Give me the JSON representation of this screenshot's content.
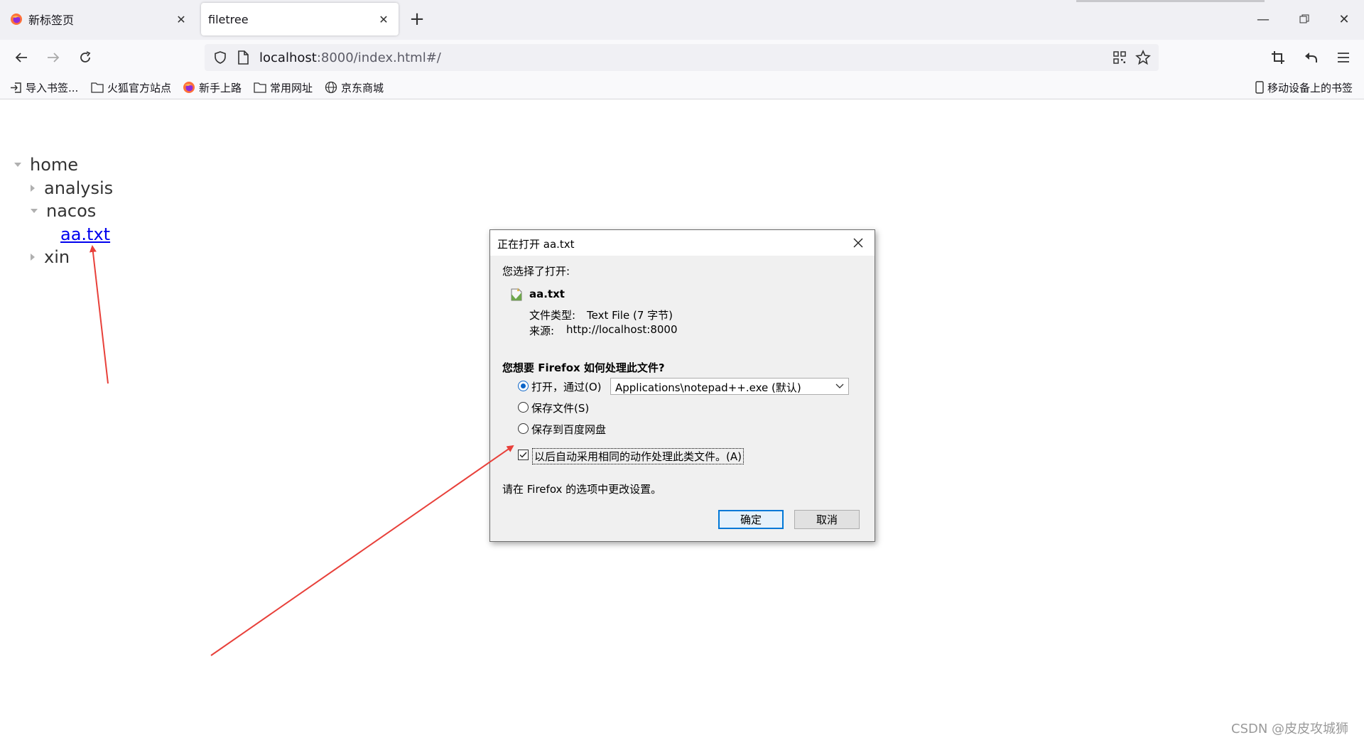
{
  "browser": {
    "tabs": [
      {
        "title": "新标签页"
      },
      {
        "title": "filetree"
      }
    ],
    "url": {
      "host": "localhost",
      "rest": ":8000/index.html#/"
    },
    "bookmarks": [
      {
        "label": "导入书签..."
      },
      {
        "label": "火狐官方站点"
      },
      {
        "label": "新手上路"
      },
      {
        "label": "常用网址"
      },
      {
        "label": "京东商城"
      }
    ],
    "mobile_bookmarks": "移动设备上的书签",
    "colors": {
      "toolbar": "#f9f9fb",
      "tabstrip": "#f0f0f4",
      "link": "#0000ee",
      "accent": "#0078d7"
    }
  },
  "tree": {
    "root": "home",
    "children": [
      {
        "label": "analysis"
      },
      {
        "label": "nacos"
      },
      {
        "label": "aa.txt"
      },
      {
        "label": "xin"
      }
    ]
  },
  "dialog": {
    "title": "正在打开 aa.txt",
    "chosen_label": "您选择了打开:",
    "file_name": "aa.txt",
    "type_label": "文件类型:",
    "type_value": "Text File (7 字节)",
    "source_label": "来源:",
    "source_value": "http://localhost:8000",
    "question": "您想要 Firefox 如何处理此文件?",
    "option_open": "打开，通过(O)",
    "open_app": "Applications\\notepad++.exe (默认)",
    "option_save": "保存文件(S)",
    "option_baidu": "保存到百度网盘",
    "auto_checkbox": "以后自动采用相同的动作处理此类文件。(A)",
    "settings_hint": "请在 Firefox 的选项中更改设置。",
    "ok_button": "确定",
    "cancel_button": "取消"
  },
  "watermark": "CSDN @皮皮攻城狮"
}
